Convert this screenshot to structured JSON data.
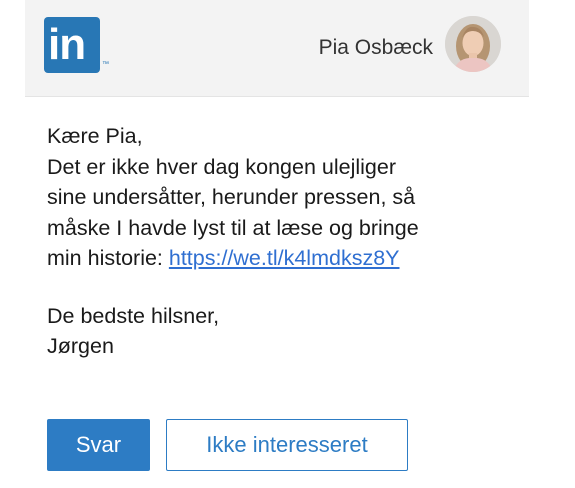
{
  "header": {
    "logo_text": "in",
    "logo_tm": "™",
    "user_name": "Pia Osbæck"
  },
  "message": {
    "greeting": "Kære Pia,",
    "lines": [
      "Det er ikke hver dag kongen ulejliger",
      "sine undersåtter, herunder pressen, så",
      "måske I havde lyst til at læse og bringe"
    ],
    "last_line_prefix": "min historie: ",
    "link_text": "https://we.tl/k4lmdksz8Y",
    "closing": "De bedste hilsner,",
    "signature": "Jørgen"
  },
  "actions": {
    "reply_label": "Svar",
    "not_interested_label": "Ikke interesseret"
  },
  "colors": {
    "linkedin_blue": "#2877b5",
    "button_blue": "#2d7cc4",
    "link_blue": "#2f6fd1",
    "header_bg": "#f3f3f3"
  }
}
